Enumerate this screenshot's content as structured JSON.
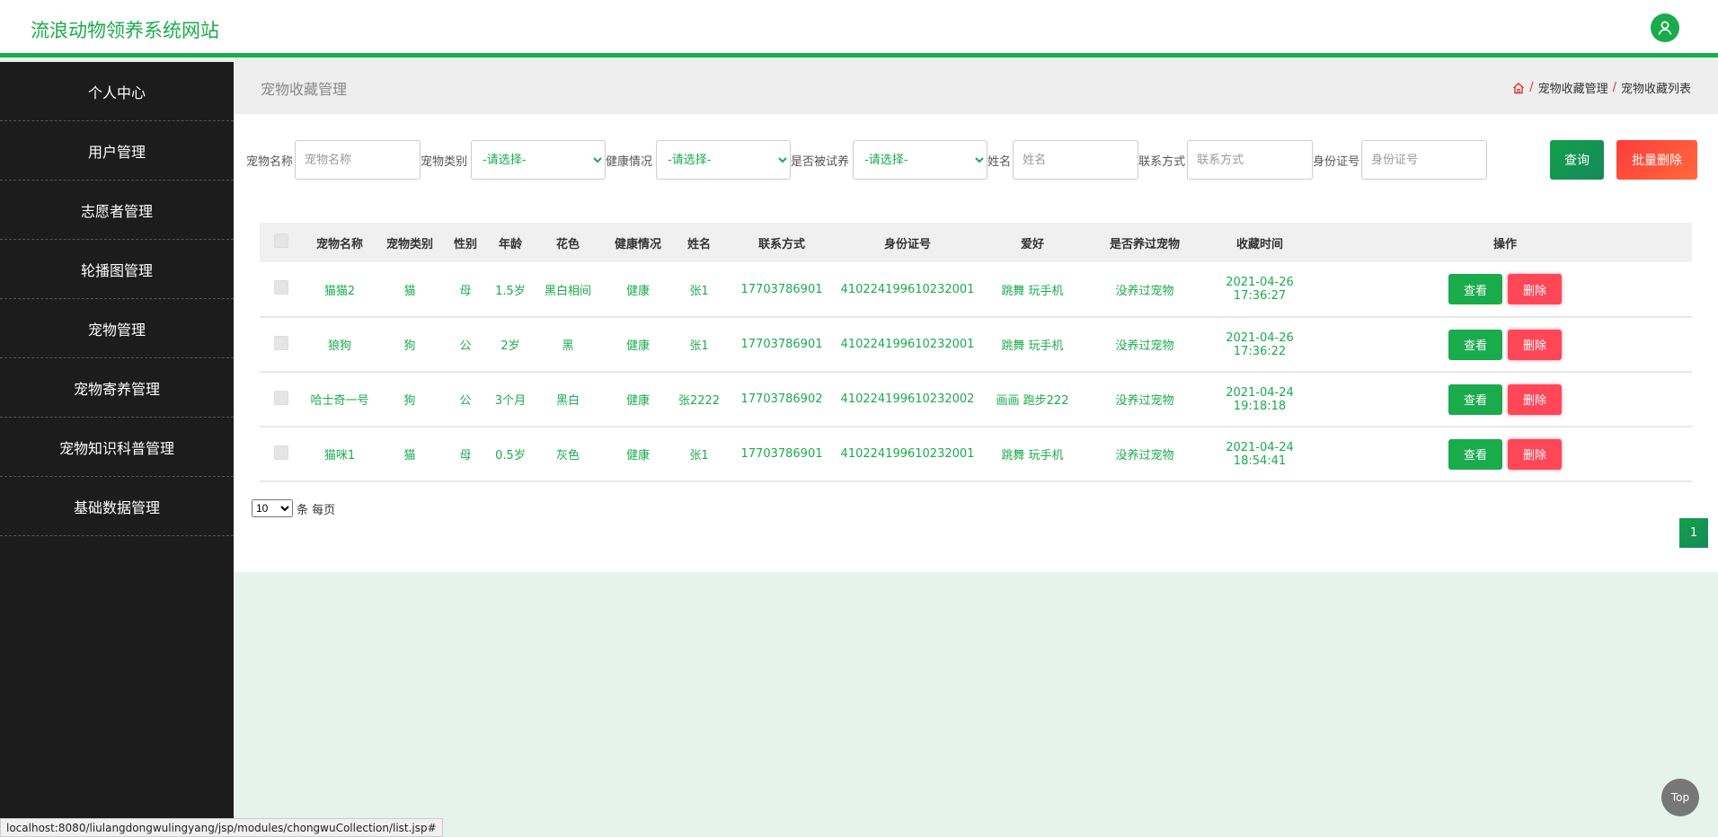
{
  "header": {
    "app_title": "流浪动物领养系统网站"
  },
  "sidebar": {
    "items": [
      {
        "label": "个人中心"
      },
      {
        "label": "用户管理"
      },
      {
        "label": "志愿者管理"
      },
      {
        "label": "轮播图管理"
      },
      {
        "label": "宠物管理"
      },
      {
        "label": "宠物寄养管理"
      },
      {
        "label": "宠物知识科普管理"
      },
      {
        "label": "基础数据管理"
      }
    ]
  },
  "page": {
    "title": "宠物收藏管理",
    "breadcrumb": [
      "宠物收藏管理",
      "宠物收藏列表"
    ],
    "breadcrumb_sep": "/"
  },
  "search": {
    "pet_name_label": "宠物名称",
    "pet_name_placeholder": "宠物名称",
    "pet_type_label": "宠物类别",
    "pet_type_selected": "-请选择-",
    "health_label": "健康情况",
    "health_selected": "-请选择-",
    "trial_label": "是否被试养",
    "trial_selected": "-请选择-",
    "name_label": "姓名",
    "name_placeholder": "姓名",
    "contact_label": "联系方式",
    "contact_placeholder": "联系方式",
    "id_label": "身份证号",
    "id_placeholder": "身份证号",
    "query_button": "查询",
    "batch_delete_button": "批量删除"
  },
  "table": {
    "columns": [
      "宠物名称",
      "宠物类别",
      "性别",
      "年龄",
      "花色",
      "健康情况",
      "姓名",
      "联系方式",
      "身份证号",
      "爱好",
      "是否养过宠物",
      "收藏时间",
      "操作"
    ],
    "rows": [
      [
        "猫猫2",
        "猫",
        "母",
        "1.5岁",
        "黑白相间",
        "健康",
        "张1",
        "17703786901",
        "410224199610232001",
        "跳舞 玩手机",
        "没养过宠物",
        "2021-04-26 17:36:27"
      ],
      [
        "狼狗",
        "狗",
        "公",
        "2岁",
        "黑",
        "健康",
        "张1",
        "17703786901",
        "410224199610232001",
        "跳舞 玩手机",
        "没养过宠物",
        "2021-04-26 17:36:22"
      ],
      [
        "哈士奇一号",
        "狗",
        "公",
        "3个月",
        "黑白",
        "健康",
        "张2222",
        "17703786902",
        "410224199610232002",
        "画画 跑步222",
        "没养过宠物",
        "2021-04-24 19:18:18"
      ],
      [
        "猫咪1",
        "猫",
        "母",
        "0.5岁",
        "灰色",
        "健康",
        "张1",
        "17703786901",
        "410224199610232001",
        "跳舞 玩手机",
        "没养过宠物",
        "2021-04-24 18:54:41"
      ]
    ],
    "view_button": "查看",
    "delete_button": "删除"
  },
  "pagination": {
    "page_size": "10",
    "page_size_options": [
      "10"
    ],
    "page_size_suffix": "条 每页",
    "current_page": "1"
  },
  "top_button": "Top",
  "status_url": "localhost:8080/liulangdongwulingyang/jsp/modules/chongwuCollection/list.jsp#",
  "colors": {
    "accent": "#1aab4c",
    "danger": "#ff4757",
    "sidebar": "#1c1c1c"
  },
  "icons": {
    "avatar": "user-icon",
    "breadcrumb_home": "home-icon"
  }
}
